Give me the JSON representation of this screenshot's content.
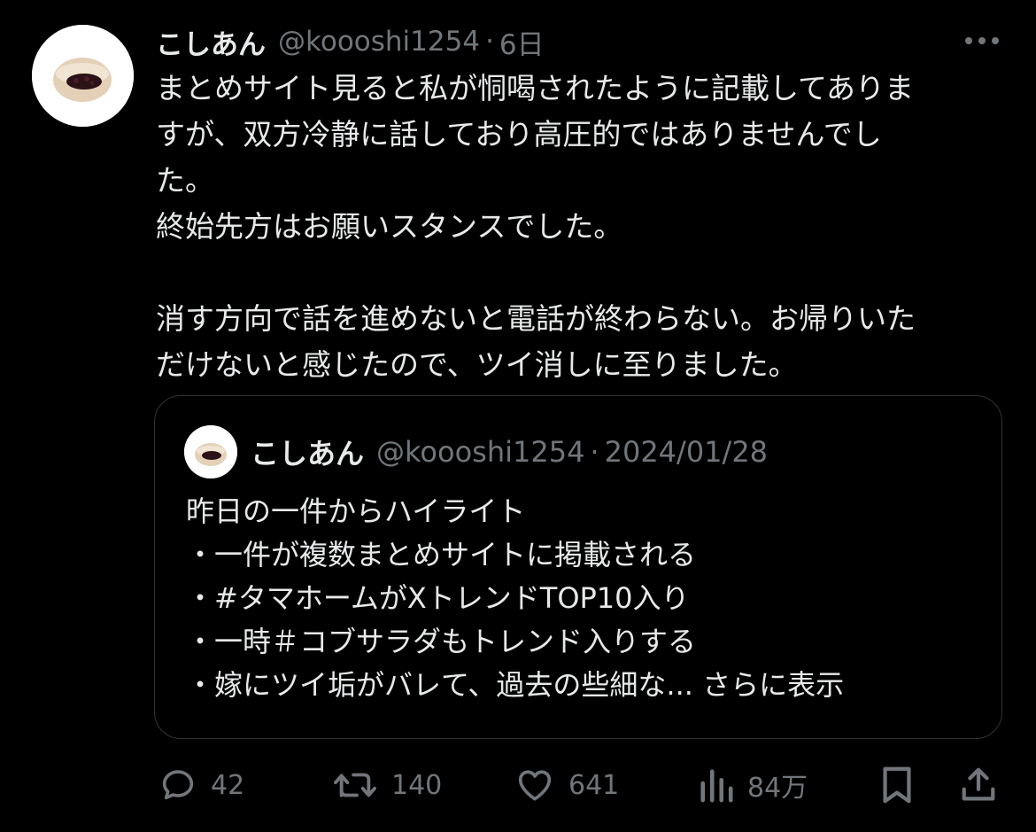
{
  "tweet": {
    "display_name": "こしあん",
    "handle": "@koooshi1254",
    "separator": "·",
    "time": "6日",
    "lines": [
      "まとめサイト見ると私が恫喝されたように記載してありま",
      "すが、双方冷静に話しており高圧的ではありませんでし",
      "た。",
      "終始先方はお願いスタンスでした。",
      "",
      "消す方向で話を進めないと電話が終わらない。お帰りいた",
      "だけないと感じたので、ツイ消しに至りました。"
    ]
  },
  "quote": {
    "display_name": "こしあん",
    "handle": "@koooshi1254",
    "separator": "·",
    "date": "2024/01/28",
    "lines": [
      "昨日の一件からハイライト",
      "・一件が複数まとめサイトに掲載される",
      "・#タマホームがXトレンドTOP10入り",
      "・一時＃コブサラダもトレンド入りする"
    ],
    "last_line_prefix": "・嫁にツイ垢がバレて、過去の些細な... ",
    "show_more": "さらに表示"
  },
  "actions": {
    "reply_count": "42",
    "retweet_count": "140",
    "like_count": "641",
    "views_count": "84万"
  },
  "icons": {
    "more": "more-dots-icon",
    "reply": "reply-icon",
    "retweet": "retweet-icon",
    "like": "heart-icon",
    "views": "views-icon",
    "bookmark": "bookmark-icon",
    "share": "share-icon"
  },
  "colors": {
    "background": "#000000",
    "text": "#e7e9ea",
    "secondary": "#71767b",
    "border": "#2f3336"
  }
}
